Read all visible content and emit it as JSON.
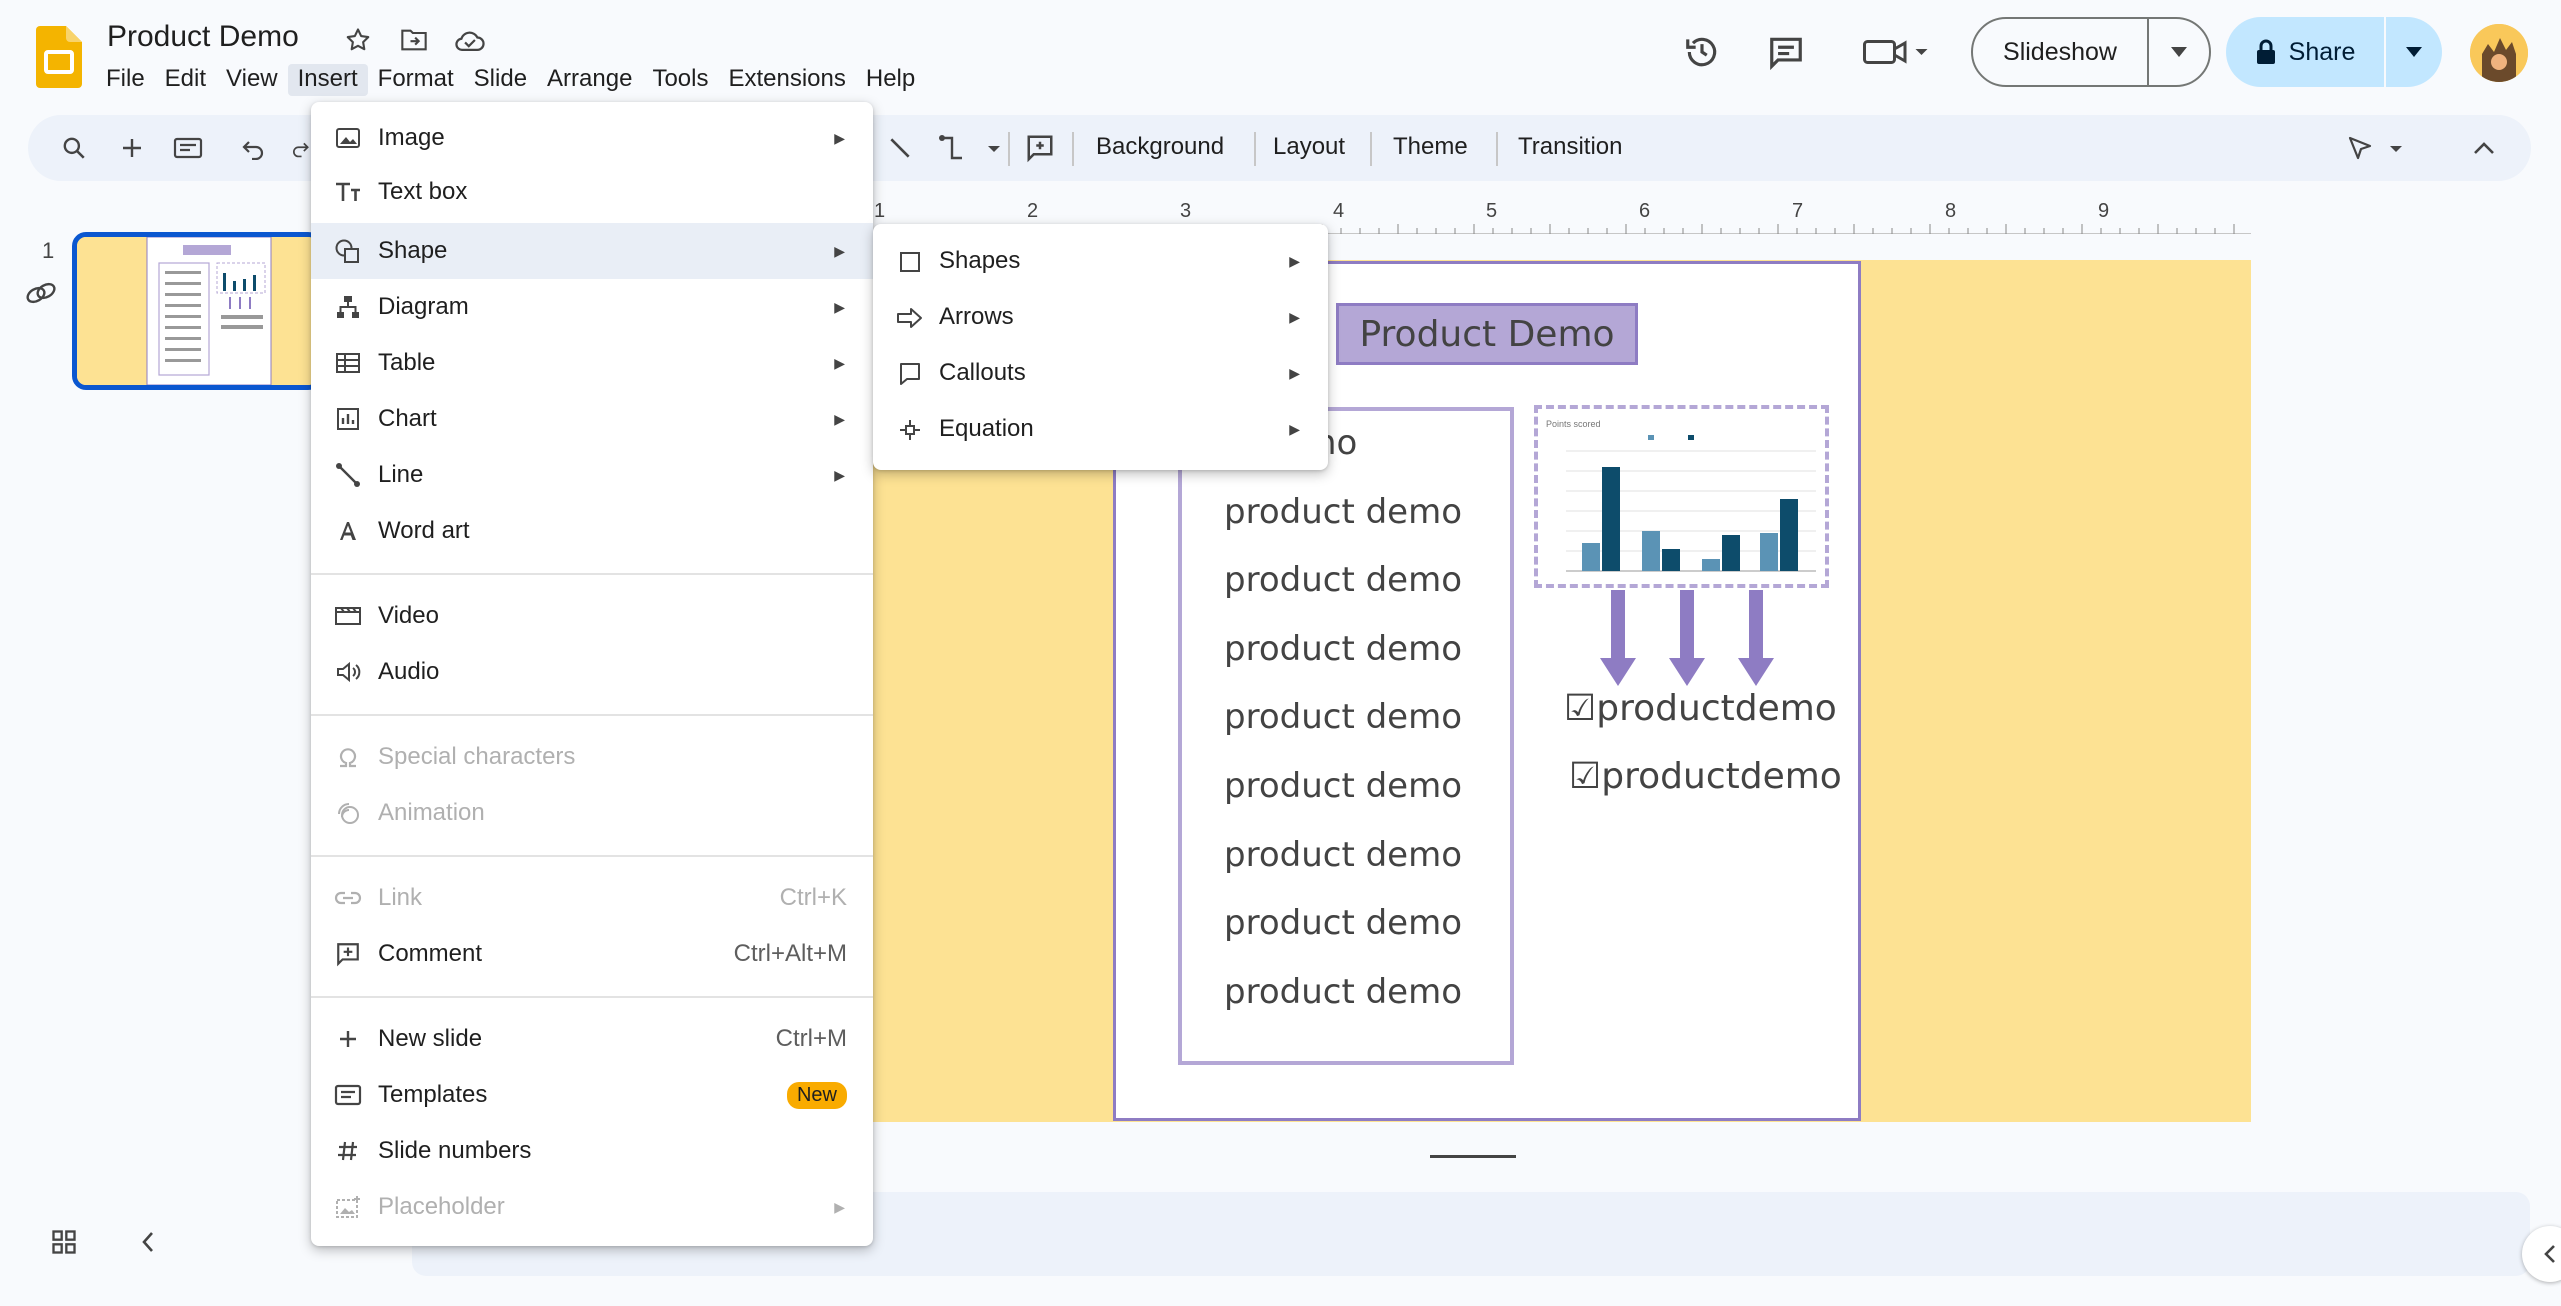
{
  "header": {
    "doc_title": "Product Demo",
    "menus": [
      "File",
      "Edit",
      "View",
      "Insert",
      "Format",
      "Slide",
      "Arrange",
      "Tools",
      "Extensions",
      "Help"
    ],
    "active_menu": "Insert",
    "slideshow_label": "Slideshow",
    "share_label": "Share"
  },
  "toolbar": {
    "background_label": "Background",
    "layout_label": "Layout",
    "theme_label": "Theme",
    "transition_label": "Transition"
  },
  "filmstrip": {
    "slide_number": "1"
  },
  "ruler": {
    "numbers": [
      "1",
      "2",
      "3",
      "4",
      "5",
      "6",
      "7",
      "8",
      "9"
    ]
  },
  "slide": {
    "title": "Product Demo",
    "list_items": [
      "product demo",
      "product demo",
      "product demo",
      "product demo",
      "product demo",
      "product demo",
      "product demo",
      "product demo",
      "product demo"
    ],
    "list_first_visible": "ct demo",
    "check_items": [
      "☑productdemo",
      "☑productdemo"
    ],
    "chart_title": "Points scored"
  },
  "insert_menu": {
    "items": [
      {
        "label": "Image",
        "icon": "image-icon",
        "submenu": true
      },
      {
        "label": "Text box",
        "icon": "text-box-icon"
      },
      {
        "label": "Shape",
        "icon": "shape-icon",
        "submenu": true,
        "highlighted": true
      },
      {
        "label": "Diagram",
        "icon": "diagram-icon",
        "submenu": true
      },
      {
        "label": "Table",
        "icon": "table-icon",
        "submenu": true
      },
      {
        "label": "Chart",
        "icon": "chart-icon",
        "submenu": true
      },
      {
        "label": "Line",
        "icon": "line-icon",
        "submenu": true
      },
      {
        "label": "Word art",
        "icon": "word-art-icon"
      },
      {
        "label": "Video",
        "icon": "video-icon"
      },
      {
        "label": "Audio",
        "icon": "audio-icon"
      },
      {
        "label": "Special characters",
        "icon": "omega-icon",
        "disabled": true
      },
      {
        "label": "Animation",
        "icon": "animation-icon",
        "disabled": true
      },
      {
        "label": "Link",
        "icon": "link-icon",
        "shortcut": "Ctrl+K",
        "disabled": true
      },
      {
        "label": "Comment",
        "icon": "comment-icon",
        "shortcut": "Ctrl+Alt+M"
      },
      {
        "label": "New slide",
        "icon": "plus-icon",
        "shortcut": "Ctrl+M"
      },
      {
        "label": "Templates",
        "icon": "templates-icon",
        "badge": "New"
      },
      {
        "label": "Slide numbers",
        "icon": "hash-icon"
      },
      {
        "label": "Placeholder",
        "icon": "placeholder-icon",
        "submenu": true,
        "disabled": true
      }
    ]
  },
  "shape_submenu": {
    "items": [
      {
        "label": "Shapes",
        "icon": "square-icon"
      },
      {
        "label": "Arrows",
        "icon": "arrow-icon"
      },
      {
        "label": "Callouts",
        "icon": "callout-icon"
      },
      {
        "label": "Equation",
        "icon": "equation-icon"
      }
    ]
  },
  "colors": {
    "accent_blue": "#0b57d0",
    "share_bg": "#c2e7ff",
    "slide_bg": "#fde293",
    "purple_border": "#8e7cc3",
    "purple_fill": "#b4a7d6"
  }
}
